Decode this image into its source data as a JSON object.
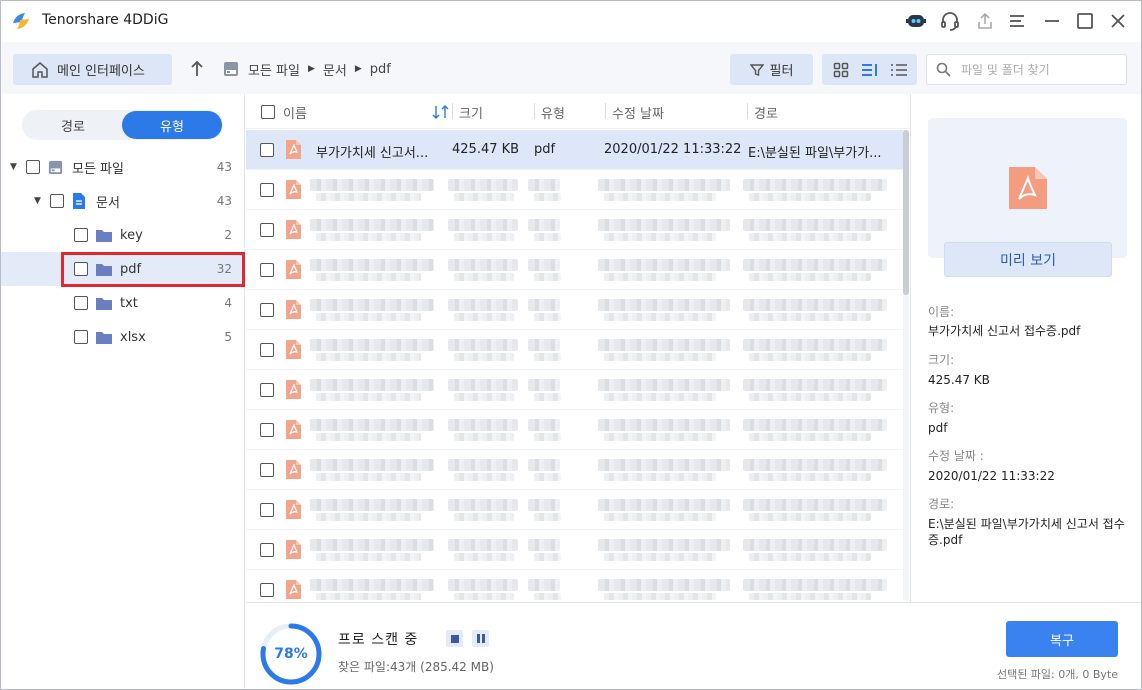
{
  "window": {
    "title": "Tenorshare 4DDiG",
    "icons": [
      "robot-icon",
      "headset-icon",
      "share-icon",
      "menu-icon",
      "minimize-icon",
      "maximize-icon",
      "close-icon"
    ]
  },
  "toolbar": {
    "home_label": "메인 인터페이스",
    "breadcrumb": [
      "모든 파일",
      "문서",
      "pdf"
    ],
    "filter_label": "필터",
    "search_placeholder": "파일 및 폴더 찾기"
  },
  "sidebar": {
    "tabs": [
      "경로",
      "유형"
    ],
    "active_tab": "유형",
    "tree": [
      {
        "label": "모든 파일",
        "count": "43"
      },
      {
        "label": "문서",
        "count": "43"
      },
      {
        "label": "key",
        "count": "2"
      },
      {
        "label": "pdf",
        "count": "32"
      },
      {
        "label": "txt",
        "count": "4"
      },
      {
        "label": "xlsx",
        "count": "5"
      }
    ]
  },
  "table": {
    "columns": [
      "이름",
      "크기",
      "유형",
      "수정 날짜",
      "경로"
    ],
    "first_row": {
      "name": "부가가치세 신고서...",
      "size": "425.47 KB",
      "type": "pdf",
      "modified": "2020/01/22 11:33:22",
      "path": "E:\\분실된 파일\\부가가..."
    }
  },
  "details": {
    "preview_label": "미리 보기",
    "name_label": "이름:",
    "name_value": "부가가치세 신고서 접수증.pdf",
    "size_label": "크기:",
    "size_value": "425.47 KB",
    "type_label": "유형:",
    "type_value": "pdf",
    "modified_label": "수정 날짜 :",
    "modified_value": "2020/01/22 11:33:22",
    "path_label": "경로:",
    "path_value": "E:\\분실된 파일\\부가가치세 신고서 접수증.pdf"
  },
  "status": {
    "progress": "78%",
    "progress_fraction": 0.78,
    "title": "프로 스캔 중",
    "found": "찾은 파일:43개 (285.42 MB)",
    "recover_label": "복구",
    "selected_info": "선택된 파일: 0개, 0 Byte"
  },
  "colors": {
    "accent": "#2c7ae8",
    "selection": "#dde7f8",
    "highlight_box": "#e0282e",
    "pdf_icon": "#f2a48c"
  }
}
